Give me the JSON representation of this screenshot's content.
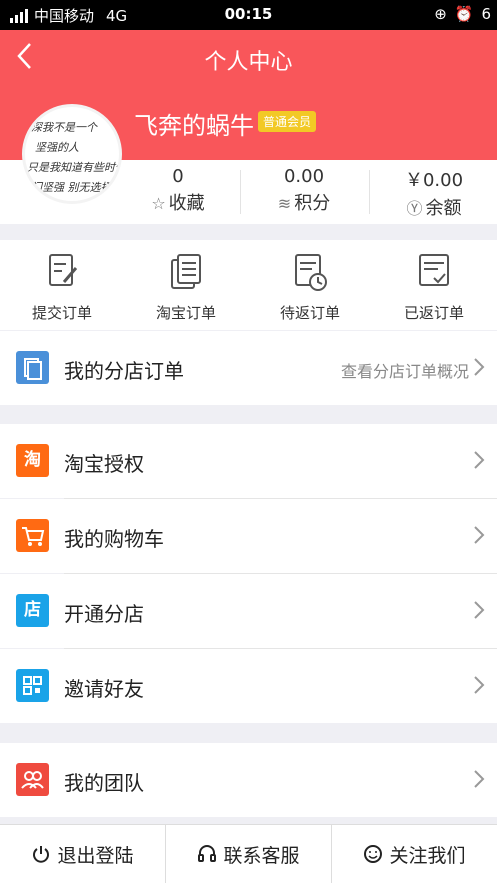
{
  "status": {
    "carrier": "中国移动",
    "network": "4G",
    "time": "00:15",
    "battery": "6"
  },
  "header": {
    "title": "个人中心",
    "username": "飞奔的蜗牛",
    "member_badge": "普通会员"
  },
  "avatar_text": [
    "深我不是一个",
    "坚强的人",
    "只是我知道有些时候",
    "门坚强  别无选择"
  ],
  "stats": [
    {
      "value": "0",
      "label": "收藏",
      "icon": "star-outline-icon"
    },
    {
      "value": "0.00",
      "label": "积分",
      "icon": "coins-icon"
    },
    {
      "value": "￥0.00",
      "label": "余额",
      "icon": "yen-circle-icon"
    }
  ],
  "orders": [
    {
      "label": "提交订单",
      "icon": "edit-doc-icon"
    },
    {
      "label": "淘宝订单",
      "icon": "doc-list-icon"
    },
    {
      "label": "待返订单",
      "icon": "doc-clock-icon"
    },
    {
      "label": "已返订单",
      "icon": "doc-check-icon"
    }
  ],
  "branch_orders": {
    "label": "我的分店订单",
    "link_text": "查看分店订单概况",
    "icon": "branch-orders-icon",
    "color": "#4a90d9"
  },
  "menu1": [
    {
      "label": "淘宝授权",
      "icon_glyph": "淘",
      "icon": "taobao-icon",
      "color": "#ff6a13"
    },
    {
      "label": "我的购物车",
      "icon_glyph": "",
      "icon": "cart-icon",
      "color": "#ff6a13"
    },
    {
      "label": "开通分店",
      "icon_glyph": "店",
      "icon": "shop-icon",
      "color": "#1aa3e8"
    },
    {
      "label": "邀请好友",
      "icon_glyph": "",
      "icon": "qr-code-icon",
      "color": "#1aa3e8"
    }
  ],
  "menu2": [
    {
      "label": "我的团队",
      "icon": "team-icon",
      "color": "#ef4b3f"
    }
  ],
  "bottom_bar": {
    "logout": "退出登陆",
    "service": "联系客服",
    "follow": "关注我们"
  },
  "colors": {
    "header_bg": "#f9565a",
    "badge_bg": "#f2c925"
  }
}
